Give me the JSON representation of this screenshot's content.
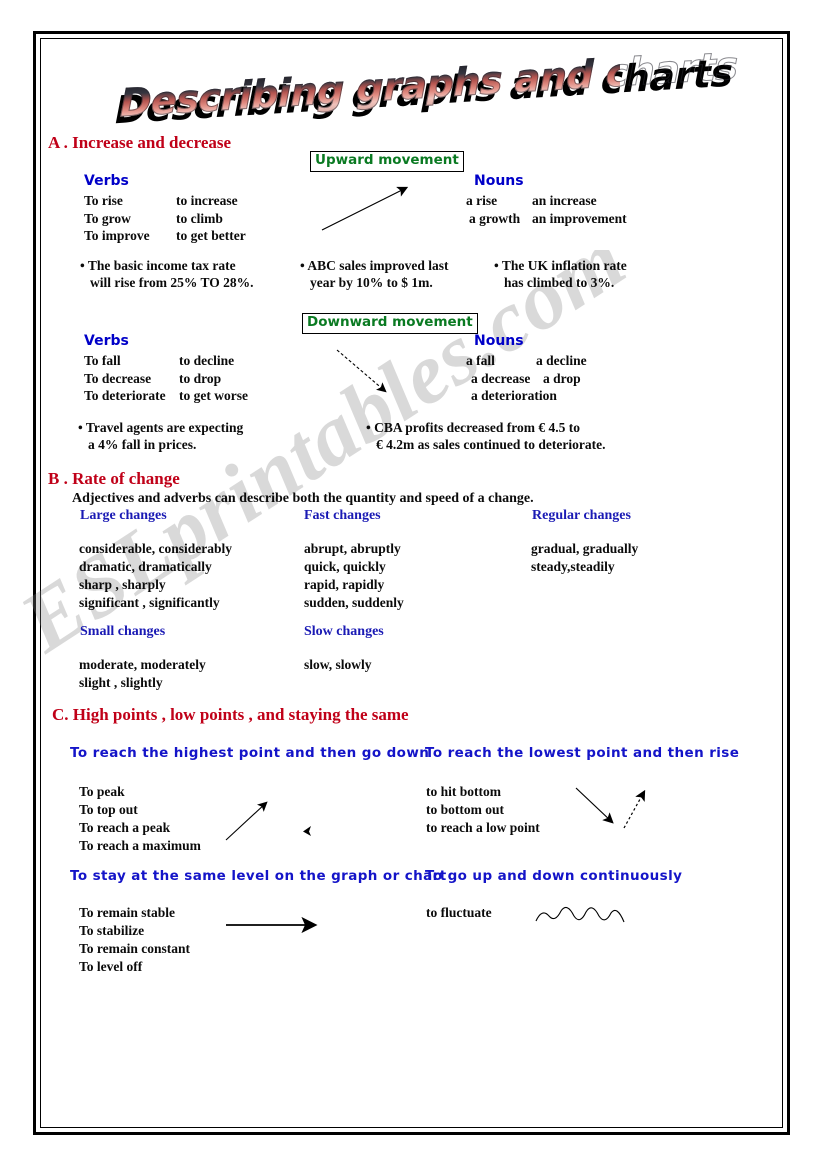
{
  "title": "Describing  graphs and  charts",
  "watermark": "ESLprintables.com",
  "sectionA": {
    "heading": "A . Increase and decrease",
    "upward_label": "Upward movement",
    "downward_label": "Downward movement",
    "up_verbs_head": "Verbs",
    "up_nouns_head": "Nouns",
    "up_verbs": [
      {
        "left": "To rise",
        "right": "to increase"
      },
      {
        "left": "To grow",
        "right": "to climb"
      },
      {
        "left": "To improve",
        "right": "to get better"
      }
    ],
    "up_nouns": [
      {
        "left": "a rise",
        "right": "an increase"
      },
      {
        "left": "a growth",
        "right": "an improvement"
      }
    ],
    "up_examples": [
      {
        "line1": "• The basic income tax rate",
        "line2": "will rise from 25% TO 28%."
      },
      {
        "line1": "• ABC sales improved last",
        "line2": "year by 10% to $ 1m."
      },
      {
        "line1": "•  The UK inflation rate",
        "line2": "has climbed to 3%."
      }
    ],
    "down_verbs_head": "Verbs",
    "down_nouns_head": "Nouns",
    "down_verbs": [
      {
        "left": "To fall",
        "right": "to decline"
      },
      {
        "left": "To decrease",
        "right": "to drop"
      },
      {
        "left": "To deteriorate",
        "right": "to get worse"
      }
    ],
    "down_nouns": [
      {
        "left": "a fall",
        "right": "a decline"
      },
      {
        "left": "a decrease",
        "right": "a drop"
      },
      {
        "left": "a deterioration",
        "right": ""
      }
    ],
    "down_examples": [
      {
        "line1": "•  Travel agents are expecting",
        "line2": "a 4% fall in prices."
      },
      {
        "line1": "•  CBA profits decreased from € 4.5 to",
        "line2": "€ 4.2m as sales continued to deteriorate."
      }
    ]
  },
  "sectionB": {
    "heading": "B . Rate of change",
    "intro": "Adjectives and adverbs can describe both the quantity and speed of a  change.",
    "col_large_head": "Large changes",
    "col_fast_head": "Fast changes",
    "col_regular_head": "Regular changes",
    "col_small_head": "Small changes",
    "col_slow_head": "Slow changes",
    "large": [
      "considerable, considerably",
      "dramatic, dramatically",
      "sharp , sharply",
      "significant , significantly"
    ],
    "fast": [
      "abrupt, abruptly",
      "quick, quickly",
      "rapid, rapidly",
      "sudden, suddenly"
    ],
    "regular": [
      "gradual, gradually",
      "steady,steadily"
    ],
    "small": [
      "moderate, moderately",
      "slight , slightly"
    ],
    "slow": [
      "slow, slowly"
    ]
  },
  "sectionC": {
    "heading": "C. High points , low points , and staying the same",
    "highest_head": "To reach the highest point and then go down",
    "lowest_head": "To reach the lowest point and then rise",
    "same_head": "To stay at the same level on the graph or chart",
    "fluctuate_head": "To go up and down continuously",
    "highest_list": [
      "To peak",
      "To top out",
      "To reach a peak",
      "To reach a maximum"
    ],
    "lowest_list": [
      "to hit bottom",
      "to bottom out",
      " to reach a low point"
    ],
    "same_list": [
      "To remain stable",
      "To stabilize",
      "To remain constant",
      "To level off"
    ],
    "fluctuate_list": [
      "to fluctuate"
    ]
  },
  "colors": {
    "section_heading": "#c00018",
    "blue_heading": "#0000c8",
    "green_label": "#0a7a22",
    "body_text": "#0b0b0b"
  }
}
